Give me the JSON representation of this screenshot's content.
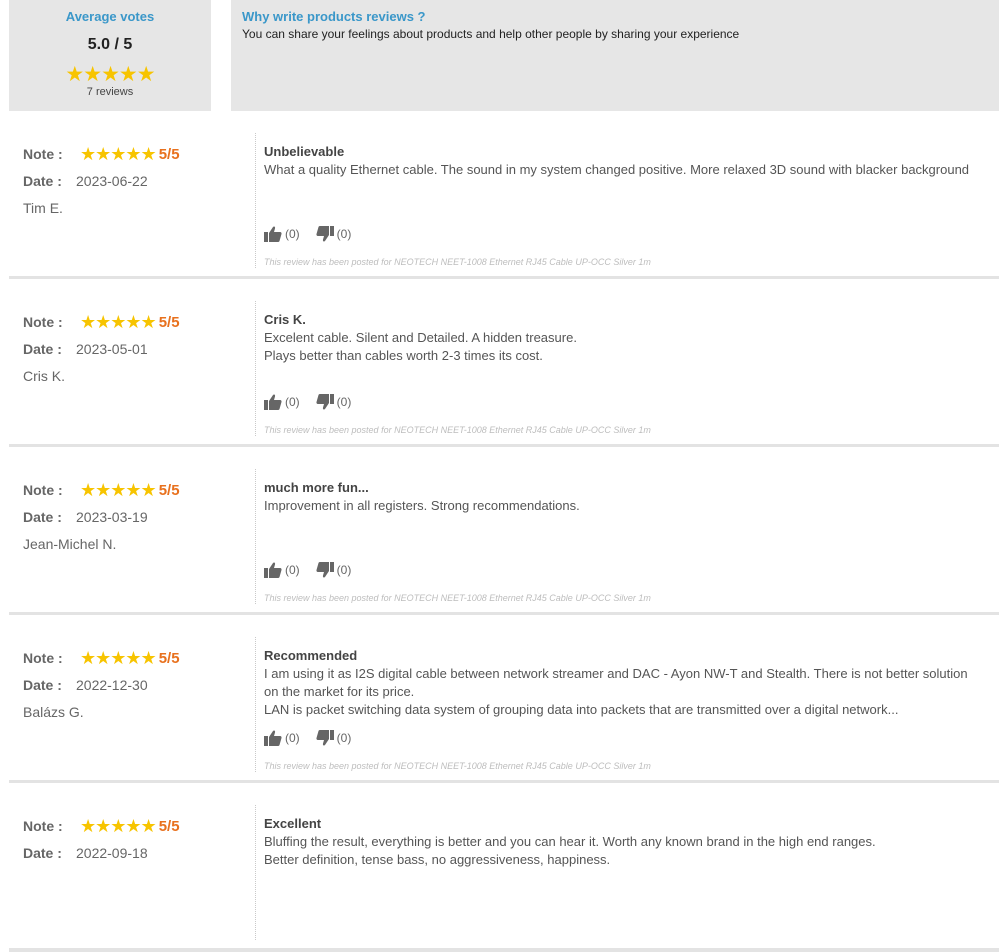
{
  "summary": {
    "title": "Average votes",
    "score": "5.0 / 5",
    "stars": "★★★★★",
    "count": "7 reviews"
  },
  "info": {
    "title": "Why write products reviews ?",
    "text": "You can share your feelings about products and help other people by sharing your experience"
  },
  "labels": {
    "note": "Note :",
    "date": "Date :"
  },
  "colors": {
    "accent": "#3a97c9",
    "star": "#f7c400",
    "rating": "#e8711e"
  },
  "reviews": [
    {
      "rating_text": "5/5",
      "stars": "★★★★★",
      "date": "2023-06-22",
      "author": "Tim E.",
      "title": "Unbelievable",
      "lines": [
        "What a quality Ethernet cable. The sound in my system changed positive. More relaxed 3D sound with blacker background"
      ],
      "up": "(0)",
      "down": "(0)",
      "posted": "This review has been posted for NEOTECH NEET-1008 Ethernet RJ45 Cable UP-OCC Silver 1m"
    },
    {
      "rating_text": "5/5",
      "stars": "★★★★★",
      "date": "2023-05-01",
      "author": "Cris K.",
      "title": "Cris K.",
      "lines": [
        "Excelent cable. Silent and Detailed. A hidden treasure.",
        "Plays better than cables worth 2-3 times its cost."
      ],
      "up": "(0)",
      "down": "(0)",
      "posted": "This review has been posted for NEOTECH NEET-1008 Ethernet RJ45 Cable UP-OCC Silver 1m"
    },
    {
      "rating_text": "5/5",
      "stars": "★★★★★",
      "date": "2023-03-19",
      "author": "Jean-Michel N.",
      "title": "much more fun...",
      "lines": [
        "Improvement in all registers. Strong recommendations."
      ],
      "up": "(0)",
      "down": "(0)",
      "posted": "This review has been posted for NEOTECH NEET-1008 Ethernet RJ45 Cable UP-OCC Silver 1m"
    },
    {
      "rating_text": "5/5",
      "stars": "★★★★★",
      "date": "2022-12-30",
      "author": "Balázs G.",
      "title": "Recommended",
      "lines": [
        "I am using it as I2S digital cable between network streamer and DAC - Ayon NW-T and Stealth. There is not better solution",
        "on the market for its price.",
        "LAN is packet switching data system of grouping data into packets that are transmitted over a digital network..."
      ],
      "up": "(0)",
      "down": "(0)",
      "posted": "This review has been posted for NEOTECH NEET-1008 Ethernet RJ45 Cable UP-OCC Silver 1m"
    },
    {
      "rating_text": "5/5",
      "stars": "★★★★★",
      "date": "2022-09-18",
      "author": "",
      "title": "Excellent",
      "lines": [
        "Bluffing the result, everything is better and you can hear it. Worth any known brand in the high end ranges.",
        "Better definition, tense bass, no aggressiveness, happiness."
      ],
      "up": "",
      "down": "",
      "posted": ""
    }
  ]
}
